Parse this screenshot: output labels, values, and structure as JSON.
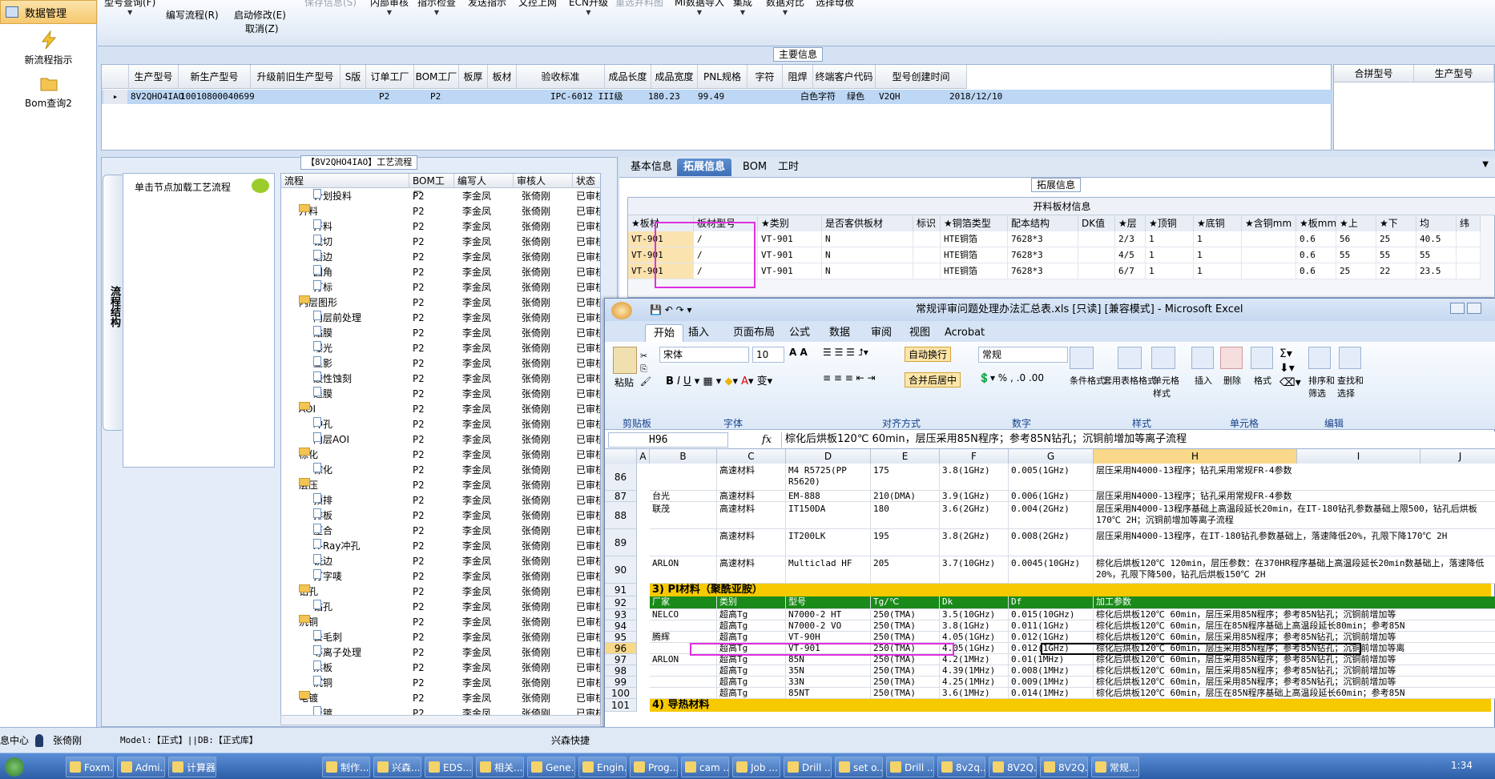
{
  "sidebar": {
    "title": "数据管理",
    "items": [
      "新流程指示",
      "Bom查询2"
    ]
  },
  "toolbar": {
    "buttons": [
      "型号查询(F)",
      "编写流程(R)",
      "启动修改(E)",
      "取消(Z)",
      "保存信息(S)",
      "内部审核",
      "指示检查",
      "发送指示",
      "文控上网",
      "ECN升级",
      "重选并料图",
      "MI数据导入",
      "集成",
      "数据对比",
      "选择母板"
    ]
  },
  "main_info": {
    "title": "主要信息",
    "columns": [
      "生产型号",
      "新生产型号",
      "升级前旧生产型号",
      "S版",
      "订单工厂",
      "BOM工厂",
      "板厚",
      "板材",
      "验收标准",
      "成品长度",
      "成品宽度",
      "PNL规格",
      "字符",
      "阻焊",
      "终端客户代码",
      "型号创建时间"
    ],
    "row": [
      "8V2QHO4IAO",
      "10010800040699",
      "",
      "",
      "P2",
      "P2",
      "",
      "",
      "IPC-6012 III级",
      "180.23",
      "99.49",
      "",
      "白色字符",
      "绿色",
      "V2QH",
      "2018/12/10"
    ]
  },
  "right_grid": {
    "columns": [
      "合拼型号",
      "生产型号"
    ]
  },
  "process": {
    "title": "【8V2QHO4IAO】工艺流程",
    "vtab": "流程结构",
    "tip": "单击节点加载工艺流程",
    "columns": [
      "流程",
      "BOM工厂",
      "编写人",
      "审核人",
      "状态"
    ],
    "rows": [
      [
        "计划投料",
        "P2",
        "李金凤",
        "张倚刚",
        "已审核",
        2
      ],
      [
        "开料",
        "P2",
        "李金凤",
        "张倚刚",
        "已审核",
        1
      ],
      [
        "开料",
        "P2",
        "李金凤",
        "张倚刚",
        "已审核",
        2
      ],
      [
        "裁切",
        "P2",
        "李金凤",
        "张倚刚",
        "已审核",
        2
      ],
      [
        "磨边",
        "P2",
        "李金凤",
        "张倚刚",
        "已审核",
        2
      ],
      [
        "圆角",
        "P2",
        "李金凤",
        "张倚刚",
        "已审核",
        2
      ],
      [
        "打标",
        "P2",
        "李金凤",
        "张倚刚",
        "已审核",
        2
      ],
      [
        "内层图形",
        "P2",
        "李金凤",
        "张倚刚",
        "已审核",
        1
      ],
      [
        "内层前处理",
        "P2",
        "李金凤",
        "张倚刚",
        "已审核",
        2
      ],
      [
        "贴膜",
        "P2",
        "李金凤",
        "张倚刚",
        "已审核",
        2
      ],
      [
        "曝光",
        "P2",
        "李金凤",
        "张倚刚",
        "已审核",
        2
      ],
      [
        "显影",
        "P2",
        "李金凤",
        "张倚刚",
        "已审核",
        2
      ],
      [
        "酸性蚀刻",
        "P2",
        "李金凤",
        "张倚刚",
        "已审核",
        2
      ],
      [
        "退膜",
        "P2",
        "李金凤",
        "张倚刚",
        "已审核",
        2
      ],
      [
        "AOI",
        "P2",
        "李金凤",
        "张倚刚",
        "已审核",
        1
      ],
      [
        "冲孔",
        "P2",
        "李金凤",
        "张倚刚",
        "已审核",
        2
      ],
      [
        "内层AOI",
        "P2",
        "李金凤",
        "张倚刚",
        "已审核",
        2
      ],
      [
        "棕化",
        "P2",
        "李金凤",
        "张倚刚",
        "已审核",
        1
      ],
      [
        "棕化",
        "P2",
        "李金凤",
        "张倚刚",
        "已审核",
        2
      ],
      [
        "层压",
        "P2",
        "李金凤",
        "张倚刚",
        "已审核",
        1
      ],
      [
        "预排",
        "P2",
        "李金凤",
        "张倚刚",
        "已审核",
        2
      ],
      [
        "排板",
        "P2",
        "李金凤",
        "张倚刚",
        "已审核",
        2
      ],
      [
        "压合",
        "P2",
        "李金凤",
        "张倚刚",
        "已审核",
        2
      ],
      [
        "X-Ray冲孔",
        "P2",
        "李金凤",
        "张倚刚",
        "已审核",
        2
      ],
      [
        "铣边",
        "P2",
        "李金凤",
        "张倚刚",
        "已审核",
        2
      ],
      [
        "打字唛",
        "P2",
        "李金凤",
        "张倚刚",
        "已审核",
        2
      ],
      [
        "钻孔",
        "P2",
        "李金凤",
        "张倚刚",
        "已审核",
        1
      ],
      [
        "钻孔",
        "P2",
        "李金凤",
        "张倚刚",
        "已审核",
        2
      ],
      [
        "沉铜",
        "P2",
        "李金凤",
        "张倚刚",
        "已审核",
        1
      ],
      [
        "去毛刺",
        "P2",
        "李金凤",
        "张倚刚",
        "已审核",
        2
      ],
      [
        "等离子处理",
        "P2",
        "李金凤",
        "张倚刚",
        "已审核",
        2
      ],
      [
        "烘板",
        "P2",
        "李金凤",
        "张倚刚",
        "已审核",
        2
      ],
      [
        "沉铜",
        "P2",
        "李金凤",
        "张倚刚",
        "已审核",
        2
      ],
      [
        "电镀",
        "P2",
        "李金凤",
        "张倚刚",
        "已审核",
        1
      ],
      [
        "板镀",
        "P2",
        "李金凤",
        "张倚刚",
        "已审核",
        2
      ]
    ]
  },
  "tabs": [
    "基本信息",
    "拓展信息",
    "BOM",
    "工时"
  ],
  "ext": {
    "title": "拓展信息",
    "sub": "开料板材信息",
    "columns": [
      "★板材",
      "板材型号",
      "★类别",
      "是否客供板材",
      "标识",
      "★铜箔类型",
      "配本结构",
      "DK值",
      "★层",
      "★顶铜",
      "★底铜",
      "★含铜mm",
      "★板mm",
      "★上",
      "★下",
      "均",
      "纬"
    ],
    "rows": [
      [
        "VT-901",
        "/",
        "VT-901",
        "N",
        "",
        "HTE铜箔",
        "7628*3",
        "",
        "2/3",
        "1",
        "1",
        "",
        "0.6",
        "56",
        "25",
        "40.5",
        ""
      ],
      [
        "VT-901",
        "/",
        "VT-901",
        "N",
        "",
        "HTE铜箔",
        "7628*3",
        "",
        "4/5",
        "1",
        "1",
        "",
        "0.6",
        "55",
        "55",
        "55",
        ""
      ],
      [
        "VT-901",
        "/",
        "VT-901",
        "N",
        "",
        "HTE铜箔",
        "7628*3",
        "",
        "6/7",
        "1",
        "1",
        "",
        "0.6",
        "25",
        "22",
        "23.5",
        ""
      ]
    ]
  },
  "excel": {
    "title": "常规评审问题处理办法汇总表.xls [只读] [兼容模式] - Microsoft Excel",
    "tabs": [
      "开始",
      "插入",
      "页面布局",
      "公式",
      "数据",
      "审阅",
      "视图",
      "Acrobat"
    ],
    "font": "宋体",
    "size": "10",
    "numfmt": "常规",
    "ribbon": {
      "paste": "粘贴",
      "wrap": "自动换行",
      "merge": "合并后居中",
      "cond": "条件格式",
      "table": "套用表格格式",
      "cellstyle": "单元格样式",
      "insert": "插入",
      "delete": "删除",
      "format": "格式",
      "sort": "排序和筛选",
      "find": "查找和选择"
    },
    "groups": [
      "剪贴板",
      "字体",
      "对齐方式",
      "数字",
      "样式",
      "单元格",
      "编辑"
    ],
    "namebox": "H96",
    "formula": "棕化后烘板120℃ 60min，层压采用85N程序；参考85N钻孔；沉铜前增加等离子流程",
    "cols": [
      "A",
      "B",
      "C",
      "D",
      "E",
      "F",
      "G",
      "H",
      "I",
      "J"
    ],
    "rows": [
      {
        "n": "86",
        "c": [
          "",
          "",
          "高速材料",
          "M4 R5725(PP R5620)",
          "175",
          "3.8(1GHz)",
          "0.005(1GHz)",
          "层压采用N4000-13程序；钻孔采用常规FR-4参数"
        ]
      },
      {
        "n": "87",
        "c": [
          "",
          "台光",
          "高速材料",
          "EM-888",
          "210(DMA)",
          "3.9(1GHz)",
          "0.006(1GHz)",
          "层压采用N4000-13程序；钻孔采用常规FR-4参数"
        ]
      },
      {
        "n": "88",
        "c": [
          "",
          "联茂",
          "高速材料",
          "IT150DA",
          "180",
          "3.6(2GHz)",
          "0.004(2GHz)",
          "层压采用N4000-13程序基础上高温段延长20min，在IT-180钻孔参数基础上限500，钻孔后烘板170℃ 2H；沉铜前增加等离子流程"
        ]
      },
      {
        "n": "89",
        "c": [
          "",
          "",
          "高速材料",
          "IT200LK",
          "195",
          "3.8(2GHz)",
          "0.008(2GHz)",
          "层压采用N4000-13程序，在IT-180钻孔参数基础上，落速降低20%，孔限下降170℃ 2H"
        ]
      },
      {
        "n": "90",
        "c": [
          "",
          "ARLON",
          "高速材料",
          "Multiclad HF",
          "205",
          "3.7(10GHz)",
          "0.0045(10GHz)",
          "棕化后烘板120℃ 120min，层压参数：在370HR程序基础上高温段延长20min数基础上，落速降低20%，孔限下降500，钻孔后烘板150℃ 2H"
        ]
      },
      {
        "n": "91",
        "c": [
          "",
          "3) PI材料（聚酰亚胺）"
        ]
      },
      {
        "n": "92",
        "c": [
          "",
          "厂家",
          "类别",
          "型号",
          "Tg/℃",
          "Dk",
          "Df",
          "加工参数"
        ]
      },
      {
        "n": "93",
        "c": [
          "",
          "NELCO",
          "超高Tg",
          "N7000-2 HT",
          "250(TMA)",
          "3.5(10GHz)",
          "0.015(10GHz)",
          "棕化后烘板120℃ 60min，层压采用85N程序；参考85N钻孔；沉铜前增加等"
        ]
      },
      {
        "n": "94",
        "c": [
          "",
          "",
          "超高Tg",
          "N7000-2 VO",
          "250(TMA)",
          "3.8(1GHz)",
          "0.011(1GHz)",
          "棕化后烘板120℃ 60min，层压在85N程序基础上高温段延长80min；参考85N"
        ]
      },
      {
        "n": "95",
        "c": [
          "",
          "腾辉",
          "超高Tg",
          "VT-90H",
          "250(TMA)",
          "4.05(1GHz)",
          "0.012(1GHz)",
          "棕化后烘板120℃ 60min，层压采用85N程序；参考85N钻孔；沉铜前增加等"
        ]
      },
      {
        "n": "96",
        "c": [
          "",
          "",
          "超高Tg",
          "VT-901",
          "250(TMA)",
          "4.05(1GHz)",
          "0.012(1GHz)",
          "棕化后烘板120℃ 60min，层压采用85N程序；参考85N钻孔；沉铜前增加等离"
        ]
      },
      {
        "n": "97",
        "c": [
          "",
          "ARLON",
          "超高Tg",
          "85N",
          "250(TMA)",
          "4.2(1MHz)",
          "0.01(1MHz)",
          "棕化后烘板120℃ 60min，层压采用85N程序；参考85N钻孔；沉铜前增加等"
        ]
      },
      {
        "n": "98",
        "c": [
          "",
          "",
          "超高Tg",
          "35N",
          "250(TMA)",
          "4.39(1MHz)",
          "0.008(1MHz)",
          "棕化后烘板120℃ 60min，层压采用85N程序；参考85N钻孔；沉铜前增加等"
        ]
      },
      {
        "n": "99",
        "c": [
          "",
          "",
          "超高Tg",
          "33N",
          "250(TMA)",
          "4.25(1MHz)",
          "0.009(1MHz)",
          "棕化后烘板120℃ 60min，层压采用85N程序；参考85N钻孔；沉铜前增加等"
        ]
      },
      {
        "n": "100",
        "c": [
          "",
          "",
          "超高Tg",
          "85NT",
          "250(TMA)",
          "3.6(1MHz)",
          "0.014(1MHz)",
          "棕化后烘板120℃ 60min，层压在85N程序基础上高温段延长60min；参考85N"
        ]
      },
      {
        "n": "101",
        "c": [
          "",
          "4) 导热材料"
        ]
      }
    ]
  },
  "status": {
    "user_prefix": "息中心",
    "user": "张倚刚",
    "model": "Model:【正式】||DB:【正式库】",
    "company": "兴森快捷"
  },
  "taskbar": {
    "items": [
      "Foxm...",
      "Admi...",
      "计算器",
      "",
      "",
      "制作...",
      "兴森...",
      "EDS...",
      "相关...",
      "Gene...",
      "Engin...",
      "Prog...",
      "cam ...",
      "Job ...",
      "Drill ...",
      "set o...",
      "Drill ...",
      "8v2q...",
      "8V2Q...",
      "8V2Q...",
      "常规..."
    ],
    "time": "1:34"
  }
}
